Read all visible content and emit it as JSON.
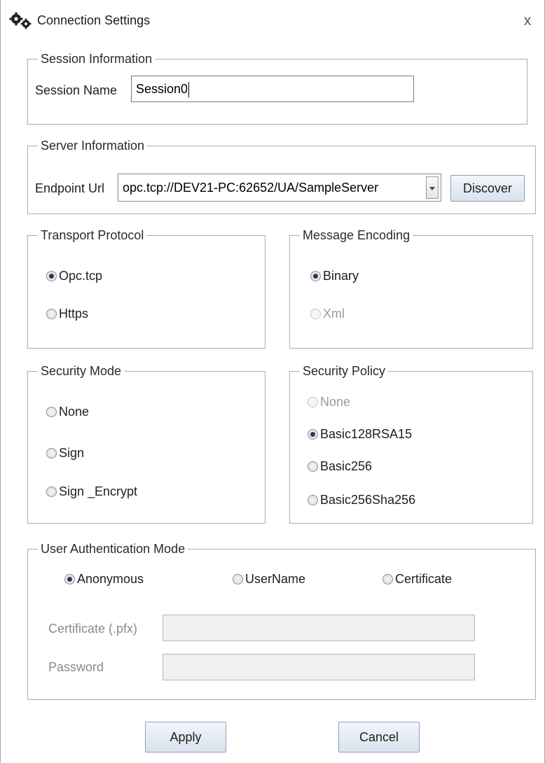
{
  "window": {
    "title": "Connection Settings",
    "close_glyph": "x",
    "icon": "gears-icon"
  },
  "session": {
    "legend": "Session Information",
    "name_label": "Session Name",
    "name_value": "Session0"
  },
  "server": {
    "legend": "Server Information",
    "endpoint_label": "Endpoint Url",
    "endpoint_value": "opc.tcp://DEV21-PC:62652/UA/SampleServer",
    "discover_label": "Discover"
  },
  "transport": {
    "legend": "Transport Protocol",
    "options": [
      {
        "label": "Opc.tcp",
        "checked": true,
        "enabled": true
      },
      {
        "label": "Https",
        "checked": false,
        "enabled": true
      }
    ]
  },
  "encoding": {
    "legend": "Message Encoding",
    "options": [
      {
        "label": "Binary",
        "checked": true,
        "enabled": true
      },
      {
        "label": "Xml",
        "checked": false,
        "enabled": false
      }
    ]
  },
  "security_mode": {
    "legend": "Security Mode",
    "options": [
      {
        "label": "None",
        "checked": false,
        "enabled": true
      },
      {
        "label": "Sign",
        "checked": false,
        "enabled": true
      },
      {
        "label": "Sign _Encrypt",
        "checked": false,
        "enabled": true
      }
    ]
  },
  "security_policy": {
    "legend": "Security Policy",
    "options": [
      {
        "label": "None",
        "checked": false,
        "enabled": false
      },
      {
        "label": "Basic128RSA15",
        "checked": true,
        "enabled": true
      },
      {
        "label": "Basic256",
        "checked": false,
        "enabled": true
      },
      {
        "label": "Basic256Sha256",
        "checked": false,
        "enabled": true
      }
    ]
  },
  "auth": {
    "legend": "User Authentication Mode",
    "options": [
      {
        "label": "Anonymous",
        "checked": true,
        "enabled": true
      },
      {
        "label": "UserName",
        "checked": false,
        "enabled": true
      },
      {
        "label": "Certificate",
        "checked": false,
        "enabled": true
      }
    ],
    "certificate_label": "Certificate (.pfx)",
    "certificate_value": "",
    "password_label": "Password",
    "password_value": ""
  },
  "buttons": {
    "apply": "Apply",
    "cancel": "Cancel"
  }
}
